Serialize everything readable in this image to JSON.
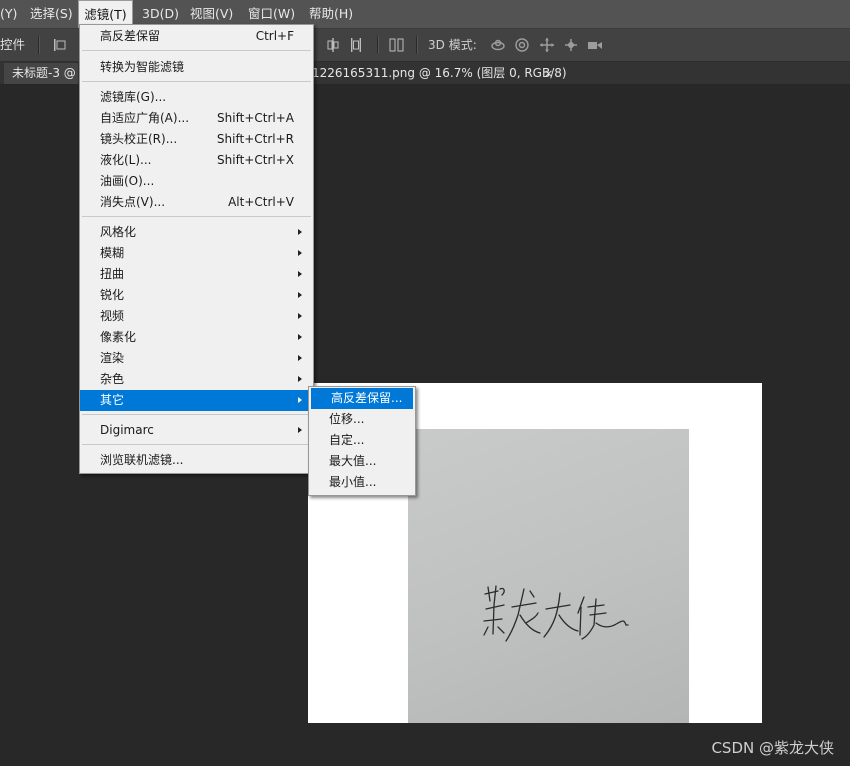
{
  "menubar": {
    "items": [
      {
        "label": "(Y)"
      },
      {
        "label": "选择(S)"
      },
      {
        "label": "滤镜(T)"
      },
      {
        "label": "3D(D)"
      },
      {
        "label": "视图(V)"
      },
      {
        "label": "窗口(W)"
      },
      {
        "label": "帮助(H)"
      }
    ]
  },
  "options_bar": {
    "label": "控件",
    "mode_3d": "3D 模式:",
    "icons": [
      "align-left-icon",
      "align-center-icon",
      "distribute-vertical-icon",
      "distribute-horizontal-icon",
      "orbit-icon",
      "roll-icon",
      "pan-icon",
      "slide-icon",
      "camera-icon"
    ]
  },
  "tabs": [
    {
      "label": "未标题-3 @"
    },
    {
      "label": "1226165311.png @ 16.7% (图层 0, RGB/8)",
      "close": "×"
    }
  ],
  "filter_menu": {
    "items": [
      {
        "label": "高反差保留",
        "shortcut": "Ctrl+F"
      },
      {
        "label": "转换为智能滤镜"
      },
      {
        "label": "滤镜库(G)..."
      },
      {
        "label": "自适应广角(A)...",
        "shortcut": "Shift+Ctrl+A"
      },
      {
        "label": "镜头校正(R)...",
        "shortcut": "Shift+Ctrl+R"
      },
      {
        "label": "液化(L)...",
        "shortcut": "Shift+Ctrl+X"
      },
      {
        "label": "油画(O)..."
      },
      {
        "label": "消失点(V)...",
        "shortcut": "Alt+Ctrl+V"
      },
      {
        "label": "风格化",
        "submenu": true
      },
      {
        "label": "模糊",
        "submenu": true
      },
      {
        "label": "扭曲",
        "submenu": true
      },
      {
        "label": "锐化",
        "submenu": true
      },
      {
        "label": "视频",
        "submenu": true
      },
      {
        "label": "像素化",
        "submenu": true
      },
      {
        "label": "渲染",
        "submenu": true
      },
      {
        "label": "杂色",
        "submenu": true
      },
      {
        "label": "其它",
        "submenu": true,
        "highlighted": true
      },
      {
        "label": "Digimarc",
        "submenu": true
      },
      {
        "label": "浏览联机滤镜..."
      }
    ]
  },
  "other_submenu": {
    "items": [
      {
        "label": "高反差保留...",
        "highlighted": true
      },
      {
        "label": "位移..."
      },
      {
        "label": "自定..."
      },
      {
        "label": "最大值..."
      },
      {
        "label": "最小值..."
      }
    ]
  },
  "colors": {
    "menubar_bg": "#535353",
    "workspace_bg": "#282828",
    "menu_bg": "#f0f0f0",
    "highlight": "#0078d7"
  },
  "watermark": "CSDN @紫龙大侠"
}
